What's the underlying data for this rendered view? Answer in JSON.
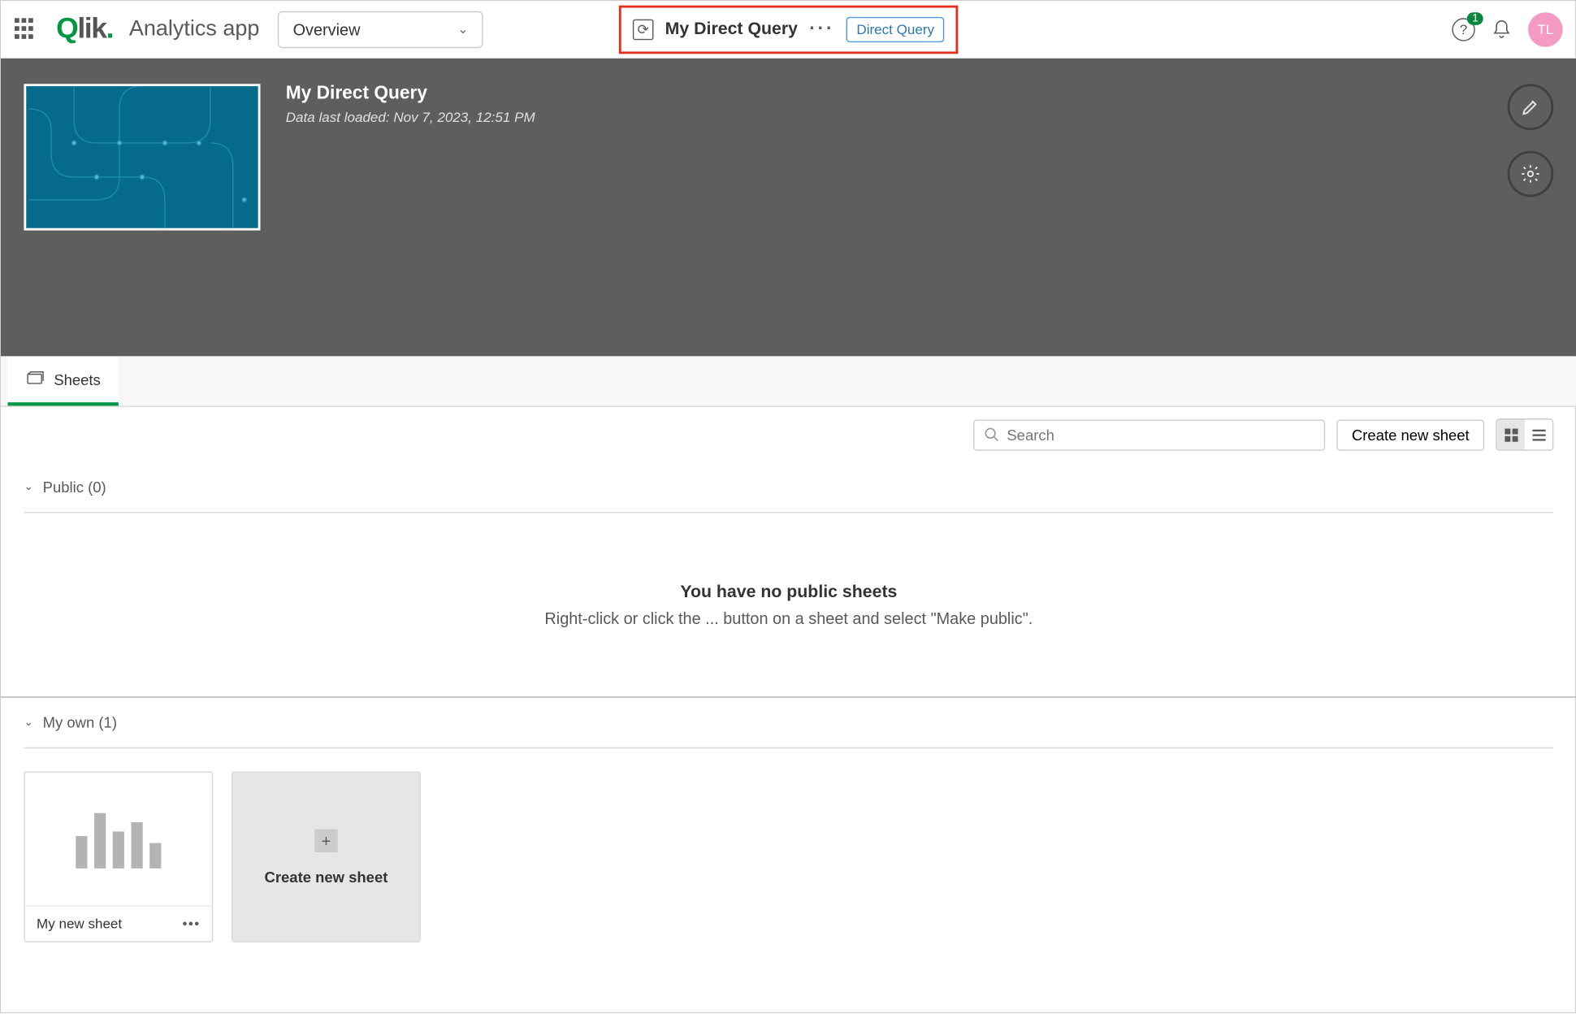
{
  "header": {
    "app_label": "Analytics app",
    "dropdown": "Overview",
    "center_title": "My Direct Query",
    "badge": "Direct Query",
    "notif_count": "1",
    "avatar": "TL"
  },
  "hero": {
    "title": "My Direct Query",
    "subtitle": "Data last loaded: Nov 7, 2023, 12:51 PM"
  },
  "tabs": {
    "sheets": "Sheets"
  },
  "toolbar": {
    "search_placeholder": "Search",
    "create": "Create new sheet"
  },
  "sections": {
    "public": {
      "label": "Public (0)",
      "empty_title": "You have no public sheets",
      "empty_desc": "Right-click or click the ... button on a sheet and select \"Make public\"."
    },
    "myown": {
      "label": "My own (1)"
    }
  },
  "cards": {
    "sheet1": "My new sheet",
    "new": "Create new sheet"
  }
}
